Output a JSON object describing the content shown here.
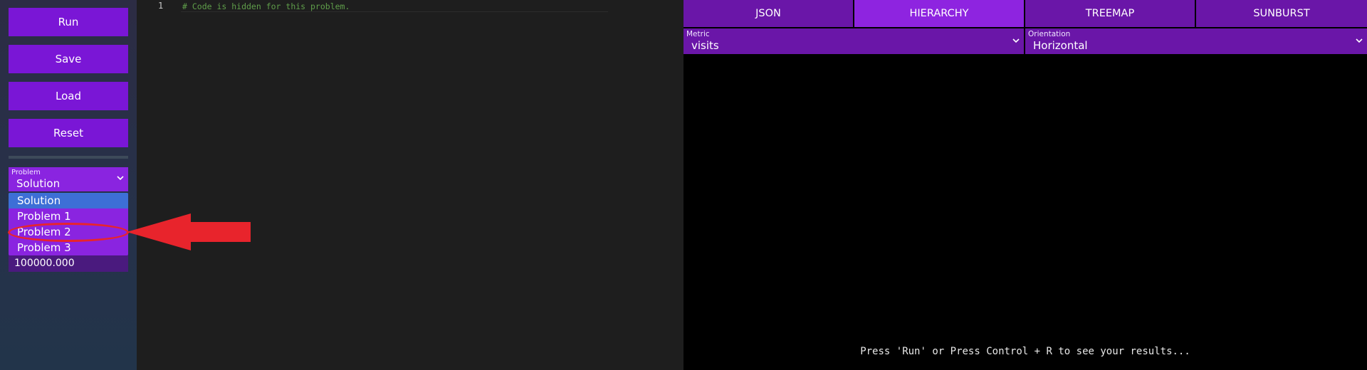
{
  "sidebar": {
    "buttons": {
      "run": "Run",
      "save": "Save",
      "load": "Load",
      "reset": "Reset"
    },
    "problem_select": {
      "label": "Problem",
      "value": "Solution",
      "options": [
        "Solution",
        "Problem 1",
        "Problem 2",
        "Problem 3"
      ]
    },
    "hidden_field": {
      "value": "100000.000"
    }
  },
  "editor": {
    "line_number": "1",
    "code": "# Code is hidden for this problem."
  },
  "panel": {
    "tabs": [
      "JSON",
      "HIERARCHY",
      "TREEMAP",
      "SUNBURST"
    ],
    "active_tab": "HIERARCHY",
    "metric": {
      "label": "Metric",
      "value": "visits"
    },
    "orientation": {
      "label": "Orientation",
      "value": "Horizontal"
    },
    "status": "Press 'Run' or Press Control + R to see your results..."
  },
  "colors": {
    "accent": "#7a16d6",
    "tab_active": "#8e24e0",
    "tab_inactive": "#6a16a8",
    "selected_option": "#3d6fd6",
    "annotation": "#e8242c"
  }
}
